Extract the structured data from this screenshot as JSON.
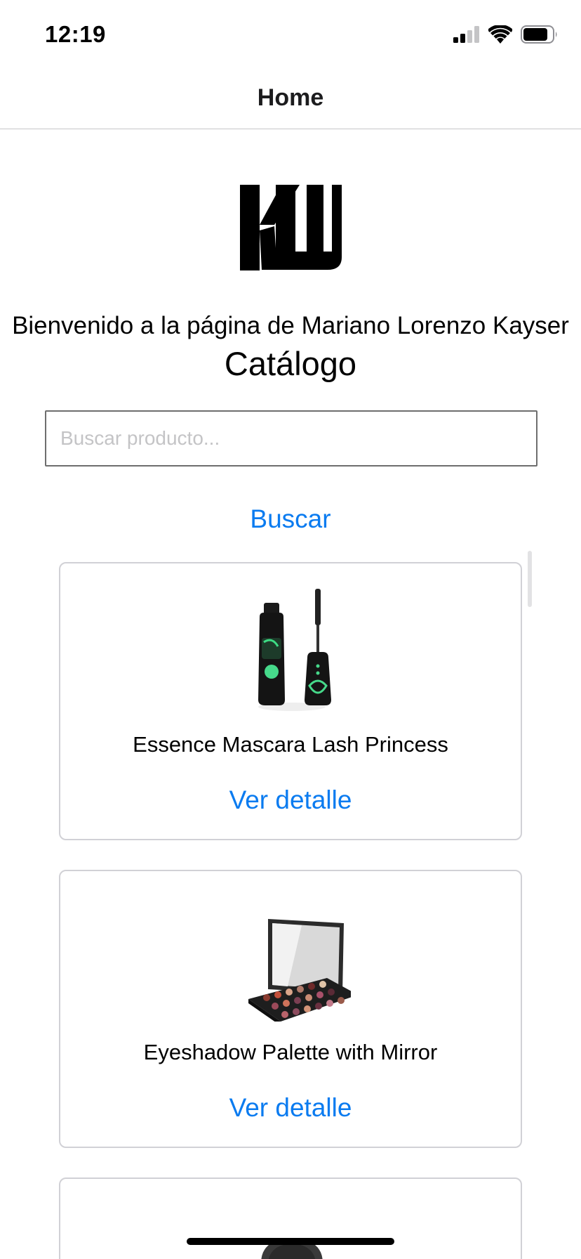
{
  "status_bar": {
    "time": "12:19"
  },
  "nav": {
    "title": "Home"
  },
  "header": {
    "welcome": "Bienvenido a la página de Mariano Lorenzo Kayser",
    "catalog_title": "Catálogo"
  },
  "search": {
    "placeholder": "Buscar producto...",
    "value": "",
    "button_label": "Buscar"
  },
  "products": [
    {
      "title": "Essence Mascara Lash Princess",
      "link_label": "Ver detalle"
    },
    {
      "title": "Eyeshadow Palette with Mirror",
      "link_label": "Ver detalle"
    }
  ],
  "colors": {
    "accent": "#0a7bf0",
    "border": "#d1d1d6"
  }
}
